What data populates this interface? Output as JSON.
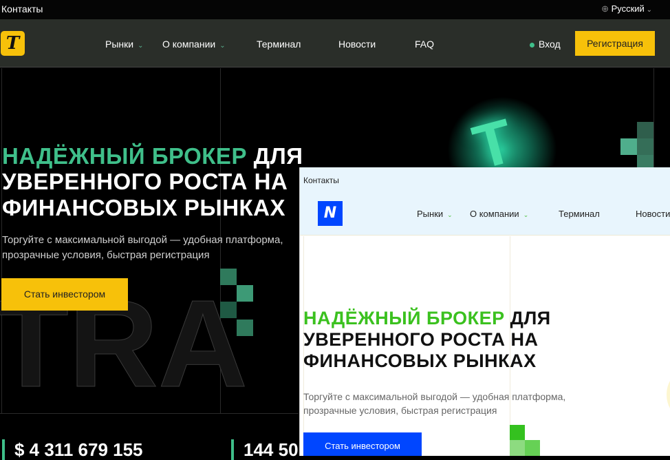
{
  "dark_site": {
    "topbar": {
      "contacts": "Контакты",
      "language": "Русский"
    },
    "nav": {
      "logo": "T",
      "items": [
        {
          "label": "Рынки",
          "dropdown": true
        },
        {
          "label": "О компании",
          "dropdown": true
        },
        {
          "label": "Терминал"
        },
        {
          "label": "Новости"
        },
        {
          "label": "FAQ"
        }
      ],
      "login": "Вход",
      "register": "Регистрация"
    },
    "hero": {
      "title_accent": "НАДЁЖНЫЙ БРОКЕР",
      "title_rest_1": " ДЛЯ",
      "title_line2": "УВЕРЕННОГО РОСТА НА",
      "title_line3": "ФИНАНСОВЫХ РЫНКАХ",
      "subtitle_1": "Торгуйте с максимальной выгодой — удобная платформа,",
      "subtitle_2": "прозрачные условия, быстрая регистрация",
      "cta": "Стать инвестором",
      "bg_word": "TRA"
    },
    "stats": [
      "$ 4 311 679 155",
      "144 50"
    ],
    "colors": {
      "accent": "#3fbf8a",
      "brand": "#f7c10a"
    }
  },
  "light_site": {
    "topbar": {
      "contacts": "Контакты"
    },
    "nav": {
      "logo": "N",
      "items": [
        {
          "label": "Рынки",
          "dropdown": true
        },
        {
          "label": "О компании",
          "dropdown": true
        },
        {
          "label": "Терминал"
        },
        {
          "label": "Новости"
        }
      ]
    },
    "hero": {
      "title_accent": "НАДЁЖНЫЙ БРОКЕР",
      "title_rest_1": " ДЛЯ",
      "title_line2": "УВЕРЕННОГО РОСТА НА",
      "title_line3": "ФИНАНСОВЫХ РЫНКАХ",
      "subtitle_1": "Торгуйте с максимальной выгодой — удобная платформа,",
      "subtitle_2": "прозрачные условия, быстрая регистрация",
      "cta": "Стать инвестором"
    },
    "colors": {
      "accent": "#3bc11f",
      "brand": "#0046ff"
    }
  }
}
